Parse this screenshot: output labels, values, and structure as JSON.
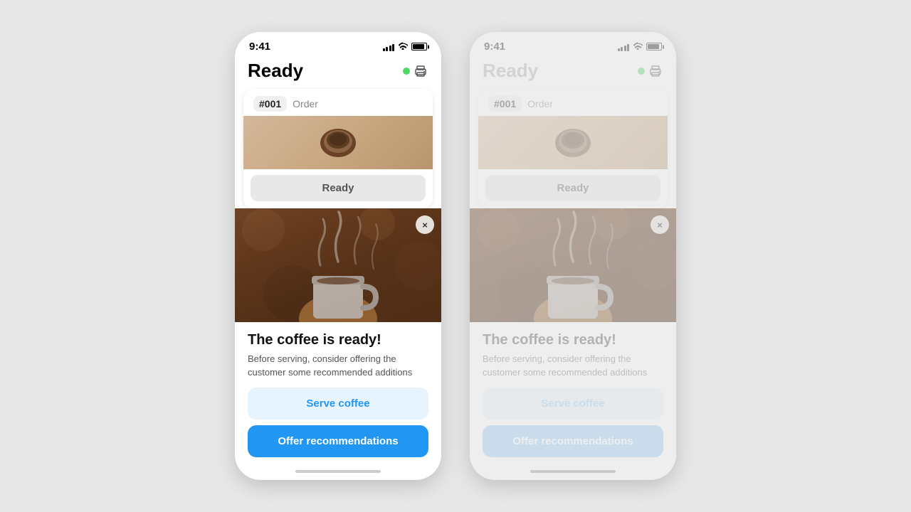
{
  "phone1": {
    "status_time": "9:41",
    "header_title": "Ready",
    "order_number": "#001",
    "order_label": "Order",
    "ready_button": "Ready",
    "notification_title": "The coffee is ready!",
    "notification_body": "Before serving, consider offering the customer some recommended additions",
    "button_serve": "Serve coffee",
    "button_recommend": "Offer recommendations",
    "close_button": "×"
  },
  "phone2": {
    "status_time": "9:41",
    "header_title": "Ready",
    "order_number": "#001",
    "order_label": "Order",
    "ready_button": "Ready",
    "notification_title": "The coffee is ready!",
    "notification_body": "Before serving, consider offering the customer some recommended additions",
    "button_serve": "Serve coffee",
    "button_recommend": "Offer recommendations",
    "close_button": "×"
  }
}
